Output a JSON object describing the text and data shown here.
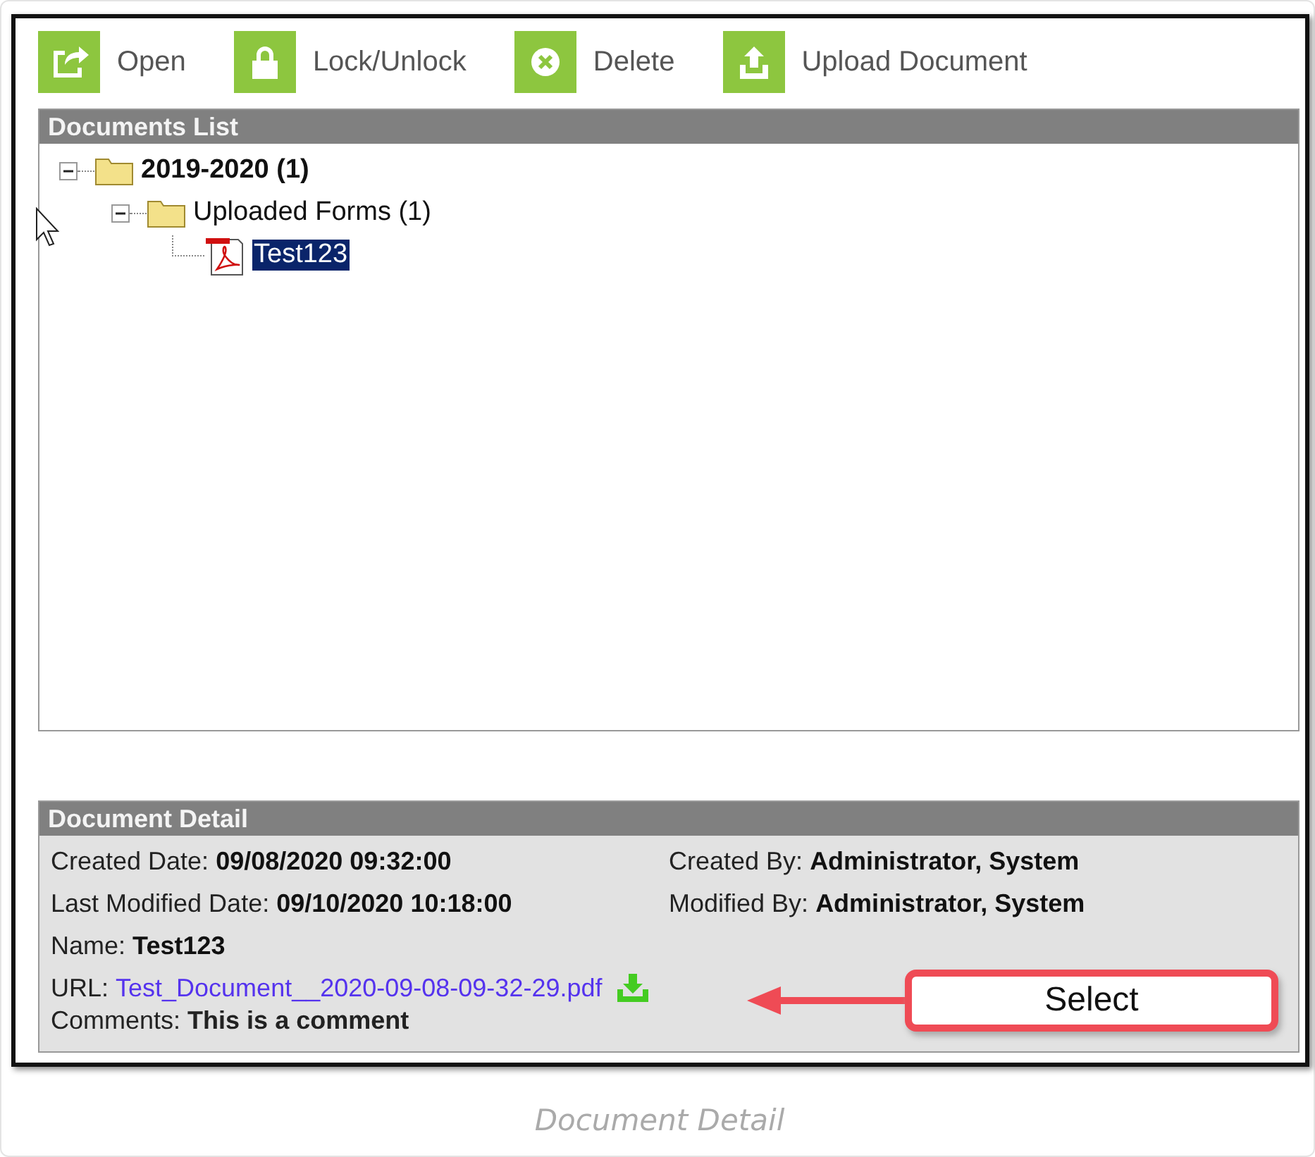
{
  "toolbar": [
    {
      "kind": "open",
      "label": "Open"
    },
    {
      "kind": "lock",
      "label": "Lock/Unlock"
    },
    {
      "kind": "delete",
      "label": "Delete"
    },
    {
      "kind": "upload",
      "label": "Upload Document"
    }
  ],
  "documents_list": {
    "title": "Documents List",
    "tree": [
      {
        "kind": "folder",
        "label": "2019-2020 (1)",
        "expanded": true,
        "selected": false,
        "children": [
          {
            "kind": "folder",
            "label": "Uploaded Forms (1)",
            "expanded": true,
            "selected": false,
            "children": [
              {
                "kind": "pdf",
                "label": "Test123",
                "selected": true
              }
            ]
          }
        ]
      }
    ]
  },
  "document_detail": {
    "title": "Document Detail",
    "rows": [
      [
        {
          "label": "Created Date:",
          "value": "09/08/2020 09:32:00"
        },
        {
          "label": "Created By:",
          "value": "Administrator, System"
        }
      ],
      [
        {
          "label": "Last Modified Date:",
          "value": "09/10/2020 10:18:00"
        },
        {
          "label": "Modified By:",
          "value": "Administrator, System"
        }
      ],
      [
        {
          "label": "Name:",
          "value": "Test123"
        }
      ]
    ],
    "url": {
      "label": "URL:",
      "link": "Test_Document__2020-09-08-09-32-29.pdf"
    },
    "comments": {
      "label": "Comments:",
      "value": "This is a comment"
    }
  },
  "callout": {
    "label": "Select"
  },
  "caption": "Document Detail"
}
